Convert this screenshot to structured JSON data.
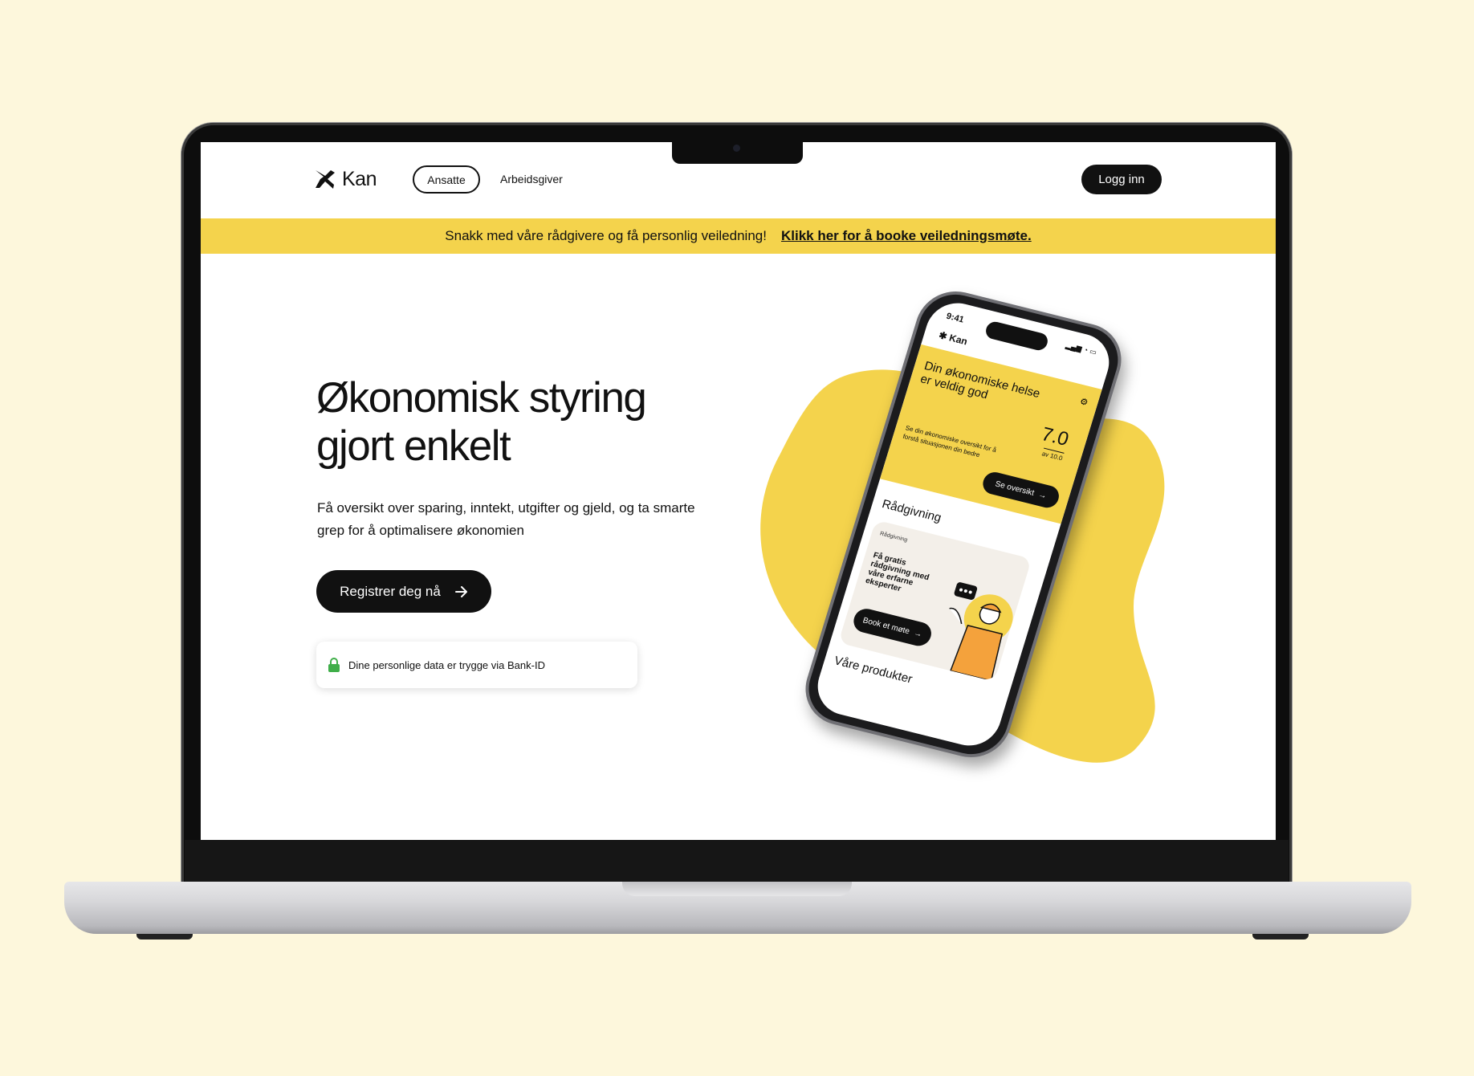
{
  "nav": {
    "logo_text": "Kan",
    "tab_active": "Ansatte",
    "tab_other": "Arbeidsgiver",
    "login": "Logg inn"
  },
  "banner": {
    "text": "Snakk med våre rådgivere og få personlig veiledning!",
    "link": "Klikk her for å booke veiledningsmøte."
  },
  "hero": {
    "title_line1": "Økonomisk styring",
    "title_line2": "gjort enkelt",
    "subtitle_line1": "Få oversikt over sparing, inntekt, utgifter og gjeld, og ta smarte",
    "subtitle_line2": "grep for å optimalisere økonomien",
    "cta": "Registrer deg nå",
    "trust": "Dine personlige data er trygge via Bank-ID"
  },
  "phone": {
    "time": "9:41",
    "logo_text": "Kan",
    "card_title": "Din økonomiske helse er veldig god",
    "score": "7.0",
    "score_sub": "av 10.0",
    "card_text": "Se din økonomiske oversikt for å forstå situasjonen din bedre",
    "overview_btn": "Se oversikt",
    "section_advice": "Rådgivning",
    "advice_tag": "Rådgivning",
    "advice_text": "Få gratis rådgivning med våre erfarne eksperter",
    "book_btn": "Book et møte",
    "section_products": "Våre produkter"
  },
  "colors": {
    "background": "#fdf7dc",
    "accent": "#f4d34c",
    "dark": "#111111",
    "lock_green": "#3fae49"
  },
  "icons": {
    "arrow": "arrow-right-icon",
    "lock": "lock-icon",
    "logo": "kan-logo-icon"
  }
}
